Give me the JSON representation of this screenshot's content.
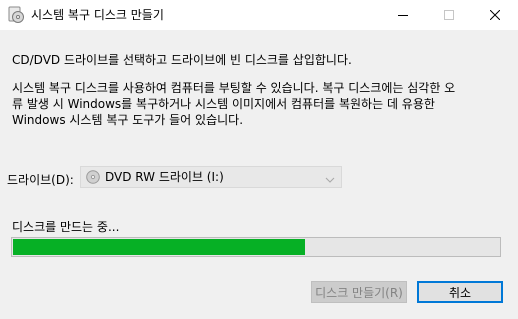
{
  "window": {
    "title": "시스템 복구 디스크 만들기",
    "controls": {
      "minimize": "minimize-icon",
      "maximize": "maximize-icon",
      "close": "close-icon"
    }
  },
  "main": {
    "intro": "CD/DVD 드라이브를 선택하고 드라이브에 빈 디스크를 삽입합니다.",
    "description_lines": [
      "시스템 복구 디스크를 사용하여 컴퓨터를 부팅할 수 있습니다. 복구 디스크에는 심각한 오",
      "류 발생 시 Windows를 복구하거나 시스템 이미지에서 컴퓨터를 복원하는 데 유용한",
      "Windows 시스템 복구 도구가 들어 있습니다."
    ],
    "drive": {
      "label": "드라이브(D):",
      "selected": "DVD RW 드라이브 (I:)",
      "icon": "disc-drive-icon"
    },
    "progress": {
      "label": "디스크를 만드는 중...",
      "fraction": 0.6,
      "color": "#06b025"
    }
  },
  "buttons": {
    "create": "디스크 만들기(R)",
    "cancel": "취소"
  },
  "colors": {
    "accent": "#0078d7",
    "progress": "#06b025"
  }
}
